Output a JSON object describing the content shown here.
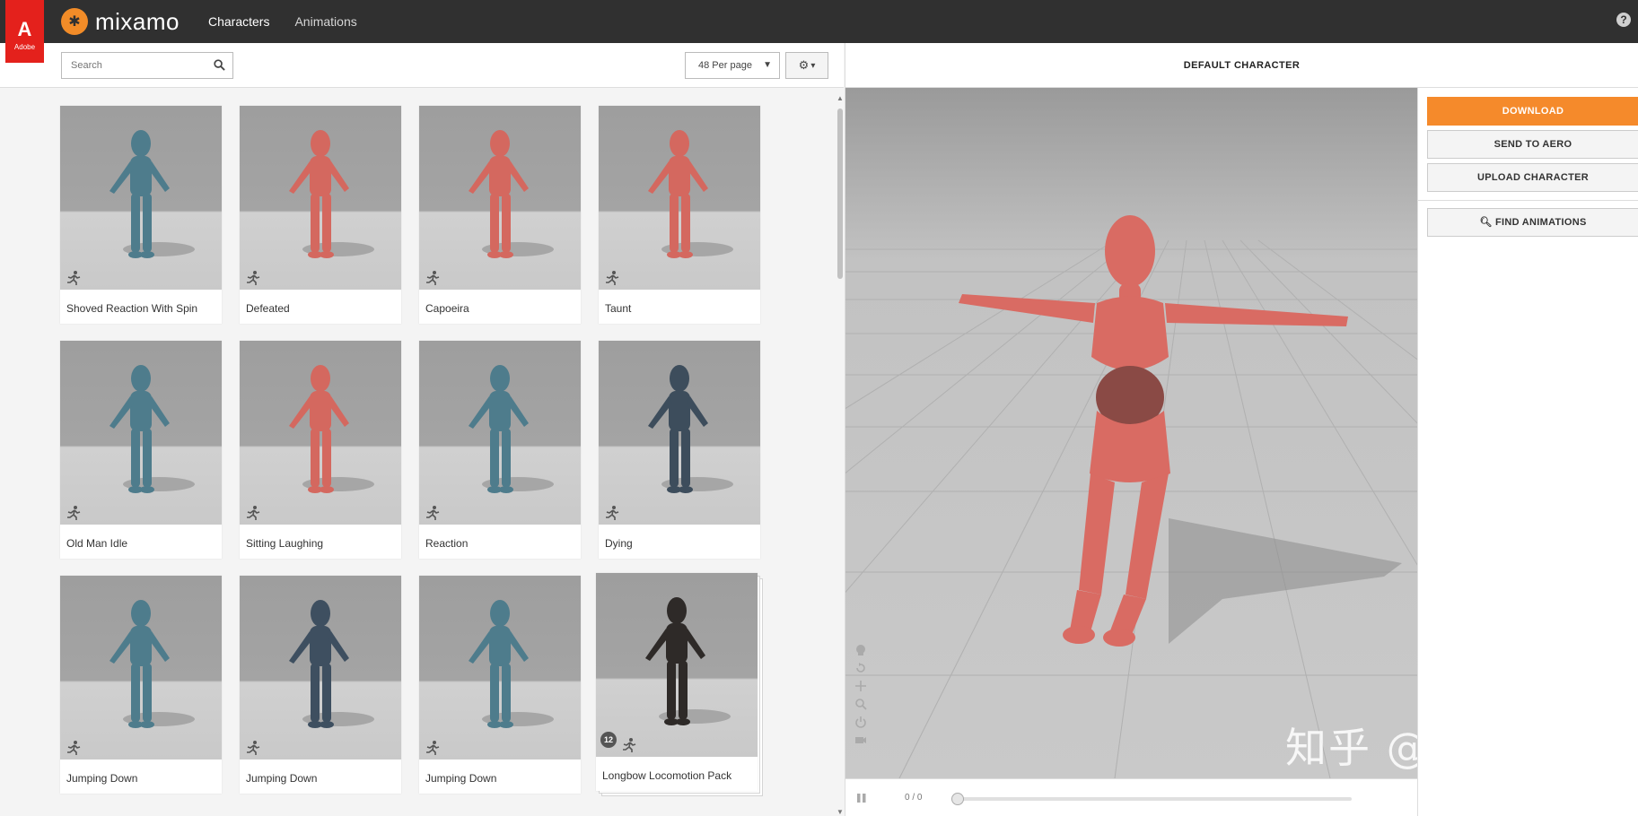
{
  "adobe": {
    "glyph": "A",
    "word": "Adobe"
  },
  "brand": {
    "logo_text": "mixamo"
  },
  "nav": {
    "items": [
      "Characters",
      "Animations"
    ]
  },
  "help": {
    "label": "?"
  },
  "toolbar": {
    "search_placeholder": "Search",
    "per_page": "48 Per page",
    "settings_caret": "▾"
  },
  "cards": [
    {
      "title": "Shoved Reaction With Spin",
      "figure_color": "#4e7c8c"
    },
    {
      "title": "Defeated",
      "figure_color": "#d4685f"
    },
    {
      "title": "Capoeira",
      "figure_color": "#d4685f"
    },
    {
      "title": "Taunt",
      "figure_color": "#d4685f"
    },
    {
      "title": "Old Man Idle",
      "figure_color": "#4e7c8c"
    },
    {
      "title": "Sitting Laughing",
      "figure_color": "#d4685f"
    },
    {
      "title": "Reaction",
      "figure_color": "#4e7c8c"
    },
    {
      "title": "Dying",
      "figure_color": "#3d4d5c"
    },
    {
      "title": "Jumping Down",
      "figure_color": "#4e7c8c"
    },
    {
      "title": "Jumping Down",
      "figure_color": "#3e4f60"
    },
    {
      "title": "Jumping Down",
      "figure_color": "#4e7c8c"
    },
    {
      "title": "Longbow Locomotion Pack",
      "figure_color": "#2e2a28",
      "pack_count": "12"
    }
  ],
  "viewer": {
    "title": "DEFAULT CHARACTER",
    "character_color": "#d96b63",
    "frame_count": "0 / 0"
  },
  "actions": {
    "download": "DOWNLOAD",
    "send_to_aero": "SEND TO AERO",
    "upload_character": "UPLOAD CHARACTER",
    "find_animations": "FIND ANIMATIONS"
  },
  "watermark": "知乎 @扬斯基",
  "colors": {
    "accent": "#f58a2b",
    "topbar": "#303030",
    "adobe_red": "#e4211c"
  }
}
